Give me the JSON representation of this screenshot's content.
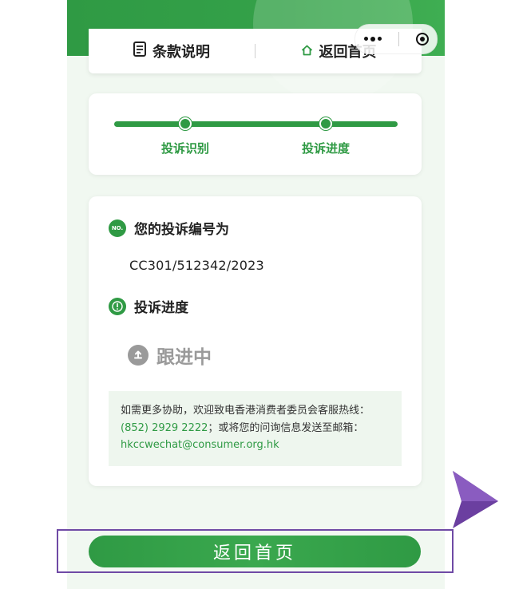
{
  "top_nav": {
    "terms_label": "条款说明",
    "terms_icon": "document-icon",
    "home_label": "返回首页",
    "home_icon": "home-icon"
  },
  "mini_program_capsule": {
    "more_icon": "more-dots-icon",
    "close_icon": "target-close-icon"
  },
  "progress": {
    "step1": "投诉识别",
    "step2": "投诉进度"
  },
  "complaint": {
    "number_heading": "您的投诉编号为",
    "number_badge": "NO.",
    "number": "CC301/512342/2023",
    "progress_heading": "投诉进度",
    "status": "跟进中"
  },
  "help": {
    "text_before_phone": "如需更多协助，欢迎致电香港消费者委员会客服热线：",
    "phone": "(852) 2929 2222",
    "text_before_email": "；或将您的问询信息发送至邮箱：",
    "email": "hkccwechat@consumer.org.hk"
  },
  "back_button_label": "返回首页",
  "colors": {
    "brand_green": "#2f9a44",
    "status_grey": "#9a9a9a",
    "highlight_outline": "#6f4aa5",
    "pointer_purple": "#6b3fa0"
  }
}
